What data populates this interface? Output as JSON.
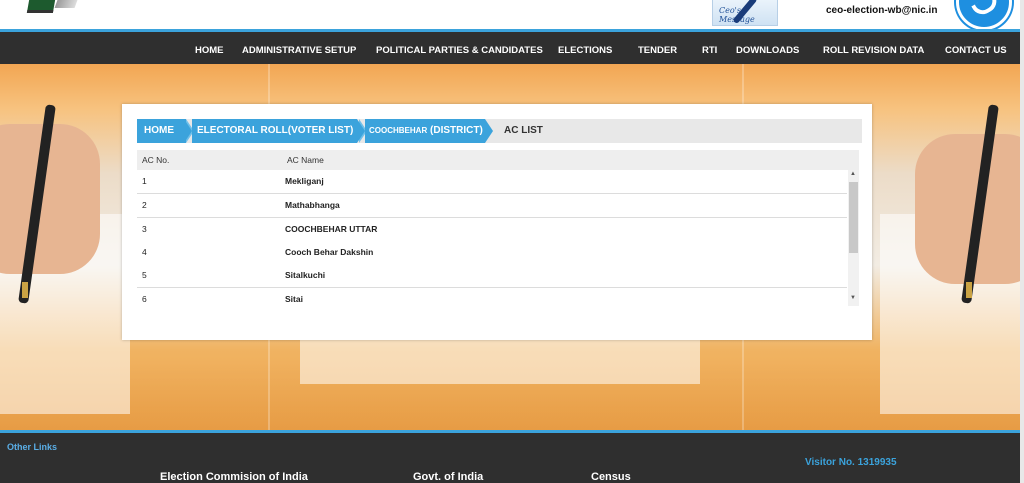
{
  "header": {
    "ceo_message_label": "Ceo's Message",
    "email": "ceo-election-wb@nic.in"
  },
  "nav": {
    "items": [
      "HOME",
      "ADMINISTRATIVE SETUP",
      "POLITICAL PARTIES & CANDIDATES",
      "ELECTIONS",
      "TENDER",
      "RTI",
      "DOWNLOADS",
      "ROLL REVISION DATA",
      "CONTACT US"
    ]
  },
  "breadcrumb": {
    "home": "HOME",
    "electoral_roll": "ELECTORAL ROLL(VOTER LIST)",
    "district_name": "COOCHBEHAR",
    "district_suffix": "(DISTRICT)",
    "current": "AC LIST"
  },
  "table": {
    "headers": [
      "AC No.",
      "AC Name"
    ],
    "rows": [
      {
        "no": "1",
        "name": "Mekliganj"
      },
      {
        "no": "2",
        "name": "Mathabhanga"
      },
      {
        "no": "3",
        "name": "COOCHBEHAR UTTAR"
      },
      {
        "no": "4",
        "name": "Cooch Behar Dakshin"
      },
      {
        "no": "5",
        "name": "Sitalkuchi"
      },
      {
        "no": "6",
        "name": "Sitai"
      }
    ]
  },
  "footer": {
    "other_links": "Other Links",
    "visitor": "Visitor No. 1319935",
    "links": [
      "Election Commision of India",
      "Govt. of India",
      "Census"
    ]
  },
  "colors": {
    "accent": "#3ba3dc",
    "nav_bg": "#2f2f2f"
  }
}
